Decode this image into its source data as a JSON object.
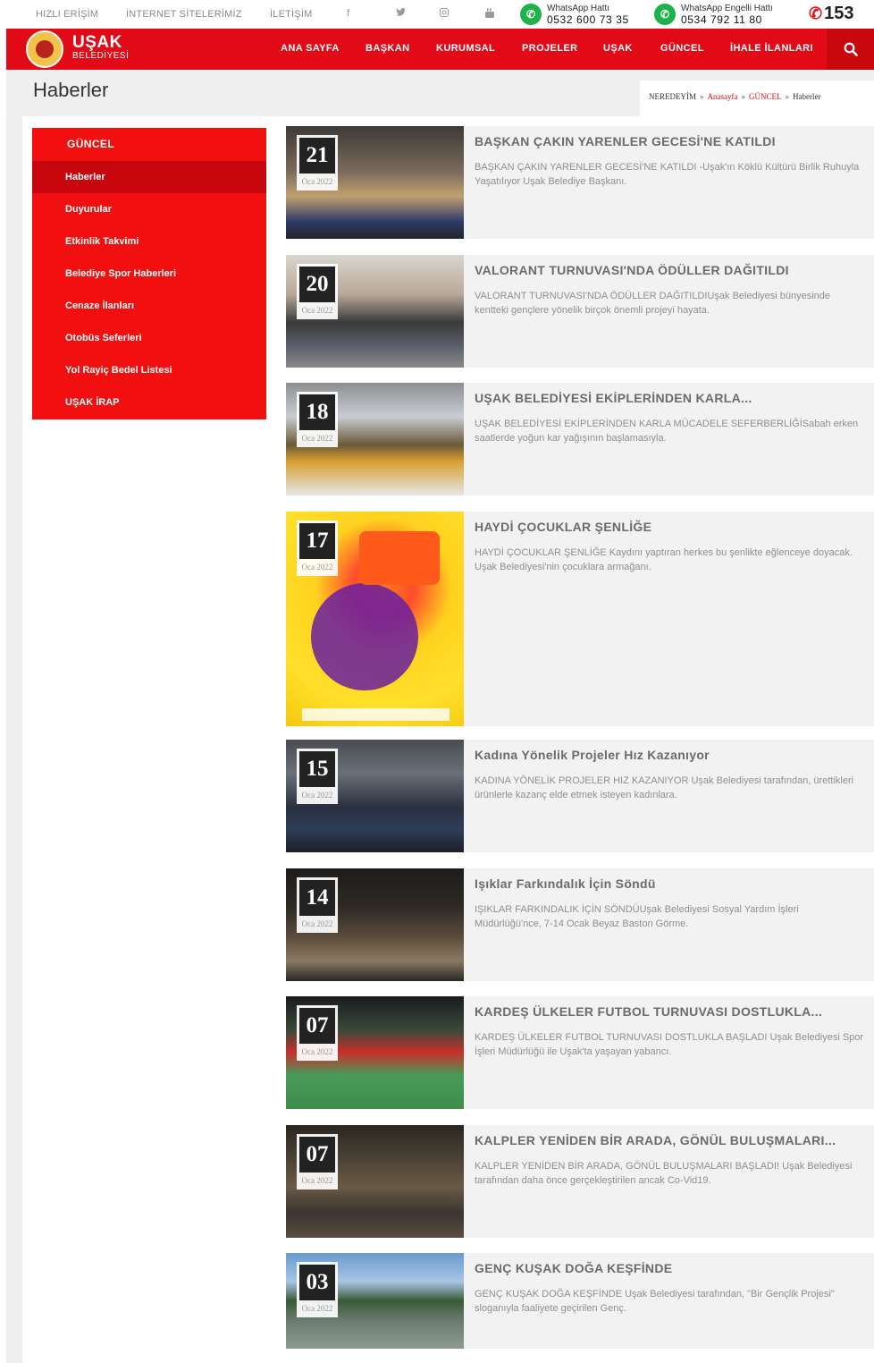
{
  "topbar": {
    "links": [
      "HIZLI ERİŞİM",
      "İNTERNET SİTELERİMİZ",
      "İLETİŞİM"
    ],
    "social_icons": [
      "facebook-icon",
      "twitter-icon",
      "instagram-icon",
      "youtube-icon"
    ],
    "whatsapp1": {
      "label": "WhatsApp Hattı",
      "number": "0532 600 73 35"
    },
    "whatsapp2": {
      "label": "WhatsApp Engelli Hattı",
      "number": "0534 792 11 80"
    },
    "hotline": "153"
  },
  "brand": {
    "name": "UŞAK",
    "sub": "BELEDİYESİ"
  },
  "nav": [
    "ANA SAYFA",
    "BAŞKAN",
    "KURUMSAL",
    "PROJELER",
    "UŞAK",
    "GÜNCEL",
    "İHALE İLANLARI"
  ],
  "page": {
    "title": "Haberler"
  },
  "breadcrumb": {
    "label": "NEREDEYİM",
    "home": "Anasayfa",
    "section": "GÜNCEL",
    "current": "Haberler"
  },
  "sidebar": {
    "heading": "GÜNCEL",
    "items": [
      "Haberler",
      "Duyurular",
      "Etkinlik Takvimi",
      "Belediye Spor Haberleri",
      "Cenaze İlanları",
      "Otobüs Seferleri",
      "Yol Rayiç Bedel Listesi",
      "UŞAK İRAP"
    ]
  },
  "colors": {
    "brand_red": "#e30a17",
    "sidebar_red": "#f20f0f",
    "active_red": "#c7050d"
  },
  "news": [
    {
      "day": "21",
      "month": "Oca 2022",
      "title": "BAŞKAN ÇAKIN YARENLER GECESİ'NE KATILDI",
      "desc": "BAŞKAN ÇAKIN YARENLER GECESİ'NE KATILDI -Uşak'ın Köklü Kültürü Birlik Ruhuyla Yaşatılıyor Uşak Belediye Başkanı."
    },
    {
      "day": "20",
      "month": "Oca 2022",
      "title": "VALORANT TURNUVASI'NDA ÖDÜLLER DAĞITILDI",
      "desc": "VALORANT TURNUVASI'NDA ÖDÜLLER DAĞITILDIUşak Belediyesi bünyesinde kentteki gençlere yönelik birçok önemli projeyi hayata."
    },
    {
      "day": "18",
      "month": "Oca 2022",
      "title": "UŞAK BELEDİYESİ EKİPLERİNDEN KARLA...",
      "desc": "UŞAK BELEDİYESİ EKİPLERİNDEN KARLA MÜCADELE SEFERBERLİĞİSabah erken saatlerde yoğun kar yağışının başlamasıyla."
    },
    {
      "day": "17",
      "month": "Oca 2022",
      "title": "HAYDİ ÇOCUKLAR ŞENLİĞE",
      "desc": "HAYDİ ÇOCUKLAR ŞENLİĞE Kaydını yaptıran herkes bu şenlikte eğlenceye doyacak. Uşak Belediyesi'nin çocuklara armağanı."
    },
    {
      "day": "15",
      "month": "Oca 2022",
      "title": "Kadına Yönelik Projeler Hız Kazanıyor",
      "desc": "KADINA YÖNELİK PROJELER HIZ KAZANIYOR Uşak Belediyesi tarafından, ürettikleri ürünlerle kazanç elde etmek isteyen kadınlara."
    },
    {
      "day": "14",
      "month": "Oca 2022",
      "title": "Işıklar Farkındalık İçin Söndü",
      "desc": "IŞIKLAR FARKINDALIK İÇİN SÖNDÜUşak Belediyesi Sosyal Yardım İşleri Müdürlüğü'nce, 7-14 Ocak Beyaz Baston Görme."
    },
    {
      "day": "07",
      "month": "Oca 2022",
      "title": "KARDEŞ ÜLKELER FUTBOL TURNUVASI DOSTLUKLA...",
      "desc": "KARDEŞ ÜLKELER FUTBOL TURNUVASI DOSTLUKLA BAŞLADI Uşak Belediyesi Spor İşleri Müdürlüğü ile Uşak'ta yaşayan yabancı."
    },
    {
      "day": "07",
      "month": "Oca 2022",
      "title": "KALPLER YENİDEN BİR ARADA, GÖNÜL BULUŞMALARI...",
      "desc": "KALPLER YENİDEN BİR ARADA, GÖNÜL BULUŞMALARI BAŞLADI! Uşak Belediyesi tarafından daha önce gerçekleştirilen ancak Co-Vid19."
    },
    {
      "day": "03",
      "month": "Oca 2022",
      "title": "GENÇ KUŞAK DOĞA KEŞFİNDE",
      "desc": "GENÇ KUŞAK DOĞA KEŞFİNDE Uşak Belediyesi tarafından, \"Bir Gençlik Projesi\" sloganıyla faaliyete geçirilen Genç."
    }
  ]
}
